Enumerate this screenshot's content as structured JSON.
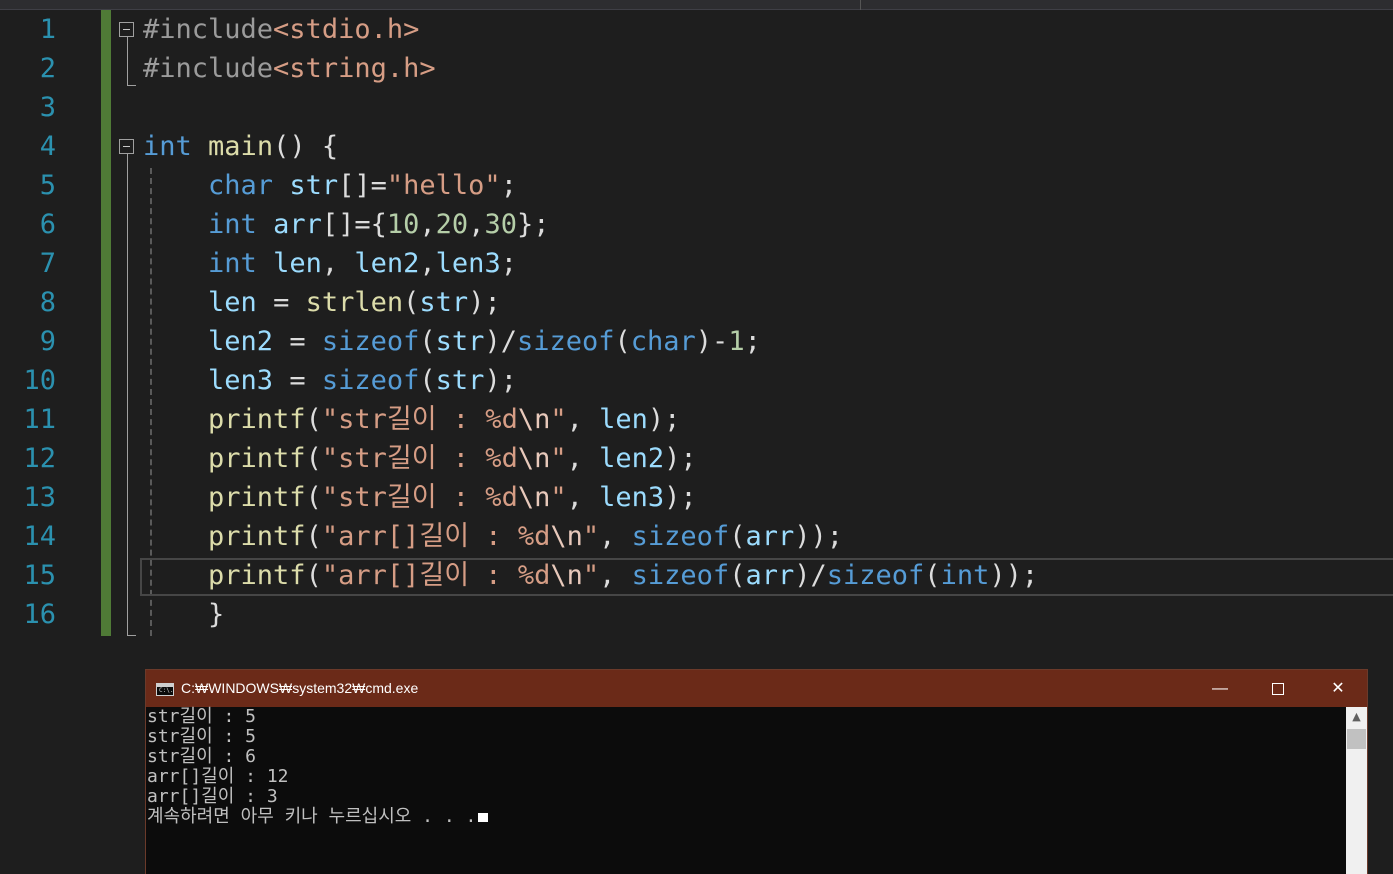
{
  "editor": {
    "line_numbers": [
      "1",
      "2",
      "3",
      "4",
      "5",
      "6",
      "7",
      "8",
      "9",
      "10",
      "11",
      "12",
      "13",
      "14",
      "15",
      "16"
    ],
    "lines": [
      [
        [
          "pp",
          "#include"
        ],
        [
          "str",
          "<stdio.h>"
        ]
      ],
      [
        [
          "pp",
          "#include"
        ],
        [
          "str",
          "<string.h>"
        ]
      ],
      [],
      [
        [
          "kw",
          "int"
        ],
        [
          "pun",
          " "
        ],
        [
          "fn",
          "main"
        ],
        [
          "pun",
          "() {"
        ]
      ],
      [
        [
          "pun",
          "    "
        ],
        [
          "kw",
          "char"
        ],
        [
          "pun",
          " "
        ],
        [
          "var",
          "str"
        ],
        [
          "pun",
          "[]="
        ],
        [
          "str",
          "\"hello\""
        ],
        [
          "pun",
          ";"
        ]
      ],
      [
        [
          "pun",
          "    "
        ],
        [
          "kw",
          "int"
        ],
        [
          "pun",
          " "
        ],
        [
          "var",
          "arr"
        ],
        [
          "pun",
          "[]={"
        ],
        [
          "num",
          "10"
        ],
        [
          "pun",
          ","
        ],
        [
          "num",
          "20"
        ],
        [
          "pun",
          ","
        ],
        [
          "num",
          "30"
        ],
        [
          "pun",
          "};"
        ]
      ],
      [
        [
          "pun",
          "    "
        ],
        [
          "kw",
          "int"
        ],
        [
          "pun",
          " "
        ],
        [
          "var",
          "len"
        ],
        [
          "pun",
          ", "
        ],
        [
          "var",
          "len2"
        ],
        [
          "pun",
          ","
        ],
        [
          "var",
          "len3"
        ],
        [
          "pun",
          ";"
        ]
      ],
      [
        [
          "pun",
          "    "
        ],
        [
          "var",
          "len"
        ],
        [
          "pun",
          " = "
        ],
        [
          "fn",
          "strlen"
        ],
        [
          "pun",
          "("
        ],
        [
          "var",
          "str"
        ],
        [
          "pun",
          ");"
        ]
      ],
      [
        [
          "pun",
          "    "
        ],
        [
          "var",
          "len2"
        ],
        [
          "pun",
          " = "
        ],
        [
          "kw",
          "sizeof"
        ],
        [
          "pun",
          "("
        ],
        [
          "var",
          "str"
        ],
        [
          "pun",
          ")/"
        ],
        [
          "kw",
          "sizeof"
        ],
        [
          "pun",
          "("
        ],
        [
          "kw",
          "char"
        ],
        [
          "pun",
          ")-"
        ],
        [
          "num",
          "1"
        ],
        [
          "pun",
          ";"
        ]
      ],
      [
        [
          "pun",
          "    "
        ],
        [
          "var",
          "len3"
        ],
        [
          "pun",
          " = "
        ],
        [
          "kw",
          "sizeof"
        ],
        [
          "pun",
          "("
        ],
        [
          "var",
          "str"
        ],
        [
          "pun",
          ");"
        ]
      ],
      [
        [
          "pun",
          "    "
        ],
        [
          "fn",
          "printf"
        ],
        [
          "pun",
          "("
        ],
        [
          "str",
          "\"str길이 : %d"
        ],
        [
          "esc",
          "\\n"
        ],
        [
          "str",
          "\""
        ],
        [
          "pun",
          ", "
        ],
        [
          "var",
          "len"
        ],
        [
          "pun",
          ");"
        ]
      ],
      [
        [
          "pun",
          "    "
        ],
        [
          "fn",
          "printf"
        ],
        [
          "pun",
          "("
        ],
        [
          "str",
          "\"str길이 : %d"
        ],
        [
          "esc",
          "\\n"
        ],
        [
          "str",
          "\""
        ],
        [
          "pun",
          ", "
        ],
        [
          "var",
          "len2"
        ],
        [
          "pun",
          ");"
        ]
      ],
      [
        [
          "pun",
          "    "
        ],
        [
          "fn",
          "printf"
        ],
        [
          "pun",
          "("
        ],
        [
          "str",
          "\"str길이 : %d"
        ],
        [
          "esc",
          "\\n"
        ],
        [
          "str",
          "\""
        ],
        [
          "pun",
          ", "
        ],
        [
          "var",
          "len3"
        ],
        [
          "pun",
          ");"
        ]
      ],
      [
        [
          "pun",
          "    "
        ],
        [
          "fn",
          "printf"
        ],
        [
          "pun",
          "("
        ],
        [
          "str",
          "\"arr[]길이 : %d"
        ],
        [
          "esc",
          "\\n"
        ],
        [
          "str",
          "\""
        ],
        [
          "pun",
          ", "
        ],
        [
          "kw",
          "sizeof"
        ],
        [
          "pun",
          "("
        ],
        [
          "var",
          "arr"
        ],
        [
          "pun",
          "));"
        ]
      ],
      [
        [
          "pun",
          "    "
        ],
        [
          "fn",
          "printf"
        ],
        [
          "pun",
          "("
        ],
        [
          "str",
          "\"arr[]길이 : %d"
        ],
        [
          "esc",
          "\\n"
        ],
        [
          "str",
          "\""
        ],
        [
          "pun",
          ", "
        ],
        [
          "kw",
          "sizeof"
        ],
        [
          "pun",
          "("
        ],
        [
          "var",
          "arr"
        ],
        [
          "pun",
          ")/"
        ],
        [
          "kw",
          "sizeof"
        ],
        [
          "pun",
          "("
        ],
        [
          "kw",
          "int"
        ],
        [
          "pun",
          "));"
        ]
      ],
      [
        [
          "pun",
          "    }"
        ]
      ]
    ]
  },
  "console": {
    "title": "C:₩WINDOWS₩system32₩cmd.exe",
    "icon": "console-window-icon",
    "icon_text": "C:\\.",
    "minimize_label": "—",
    "close_label": "✕",
    "output_lines": [
      "str길이 : 5",
      "str길이 : 5",
      "str길이 : 6",
      "arr[]길이 : 12",
      "arr[]길이 : 3",
      "계속하려면 아무 키나 누르십시오 . . ."
    ],
    "scroll_up_label": "▲"
  }
}
